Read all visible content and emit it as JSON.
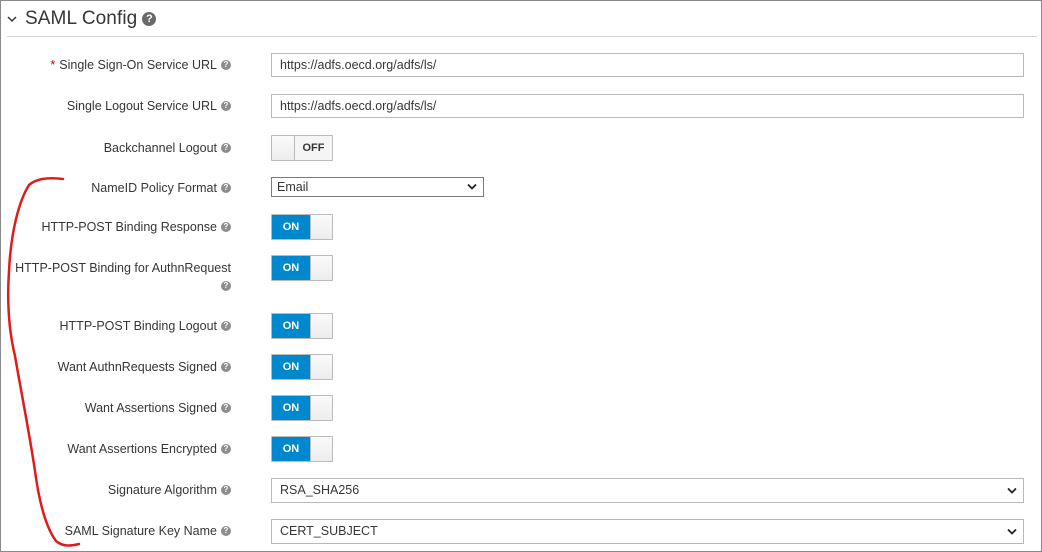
{
  "section": {
    "title": "SAML Config",
    "help": "?"
  },
  "fields": {
    "sso_url": {
      "required_marker": "*",
      "label": "Single Sign-On Service URL",
      "value": "https://adfs.oecd.org/adfs/ls/"
    },
    "slo_url": {
      "label": "Single Logout Service URL",
      "value": "https://adfs.oecd.org/adfs/ls/"
    },
    "backchannel": {
      "label": "Backchannel Logout",
      "state": "OFF"
    },
    "nameid": {
      "label": "NameID Policy Format",
      "value": "Email"
    },
    "post_response": {
      "label": "HTTP-POST Binding Response",
      "state": "ON"
    },
    "post_authn": {
      "label": "HTTP-POST Binding for AuthnRequest",
      "state": "ON"
    },
    "post_logout": {
      "label": "HTTP-POST Binding Logout",
      "state": "ON"
    },
    "authn_signed": {
      "label": "Want AuthnRequests Signed",
      "state": "ON"
    },
    "assert_signed": {
      "label": "Want Assertions Signed",
      "state": "ON"
    },
    "assert_encrypted": {
      "label": "Want Assertions Encrypted",
      "state": "ON"
    },
    "sig_alg": {
      "label": "Signature Algorithm",
      "value": "RSA_SHA256"
    },
    "sig_key": {
      "label": "SAML Signature Key Name",
      "value": "CERT_SUBJECT"
    }
  },
  "help_icon": "?",
  "colors": {
    "toggle_on": "#0088ce",
    "required": "#cc0000",
    "annotation": "#e01b1b"
  },
  "icons": {
    "collapse": "chevron-down-icon",
    "help": "question-circle-icon",
    "dropdown": "caret-down-icon"
  }
}
